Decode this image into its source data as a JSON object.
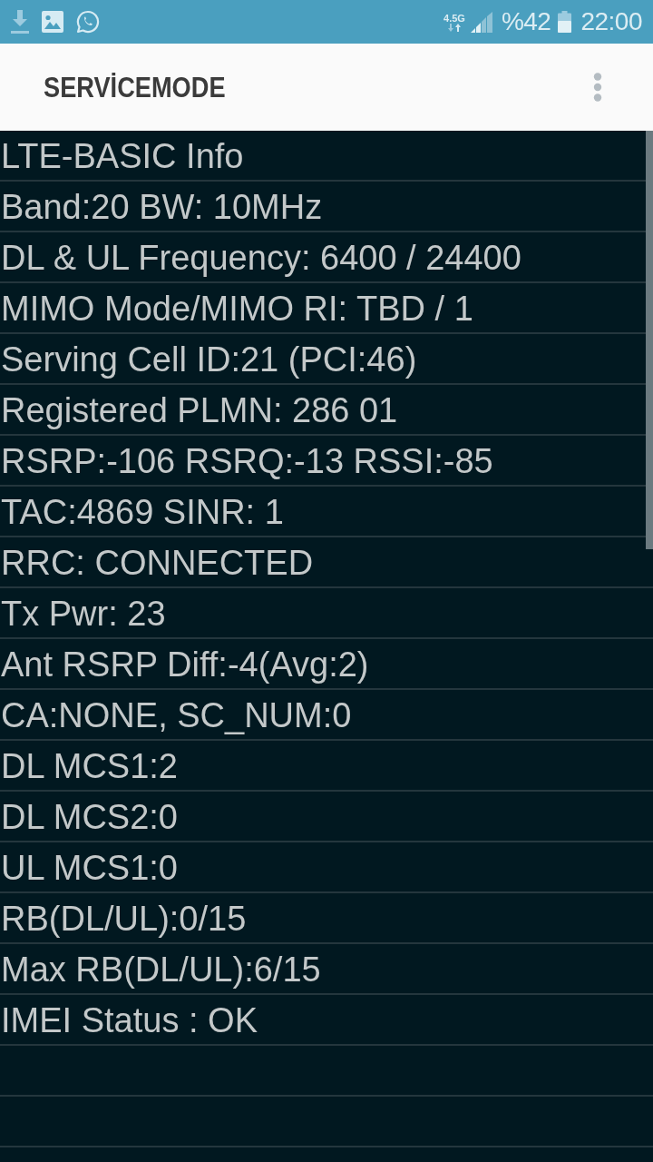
{
  "status_bar": {
    "network_type": "4.5G",
    "battery": "%42",
    "time": "22:00"
  },
  "app_bar": {
    "title": "SERVİCEMODE"
  },
  "info_lines": [
    "LTE-BASIC Info",
    "Band:20 BW: 10MHz",
    "DL & UL Frequency: 6400 / 24400",
    "MIMO Mode/MIMO RI: TBD / 1",
    "Serving Cell ID:21 (PCI:46)",
    "Registered PLMN: 286 01",
    "RSRP:-106 RSRQ:-13 RSSI:-85",
    "TAC:4869 SINR: 1",
    "RRC: CONNECTED",
    "Tx Pwr: 23",
    "Ant RSRP Diff:-4(Avg:2)",
    "CA:NONE, SC_NUM:0",
    "DL MCS1:2",
    "DL MCS2:0",
    "UL MCS1:0",
    "RB(DL/UL):0/15",
    "Max RB(DL/UL):6/15",
    "IMEI Status : OK"
  ]
}
